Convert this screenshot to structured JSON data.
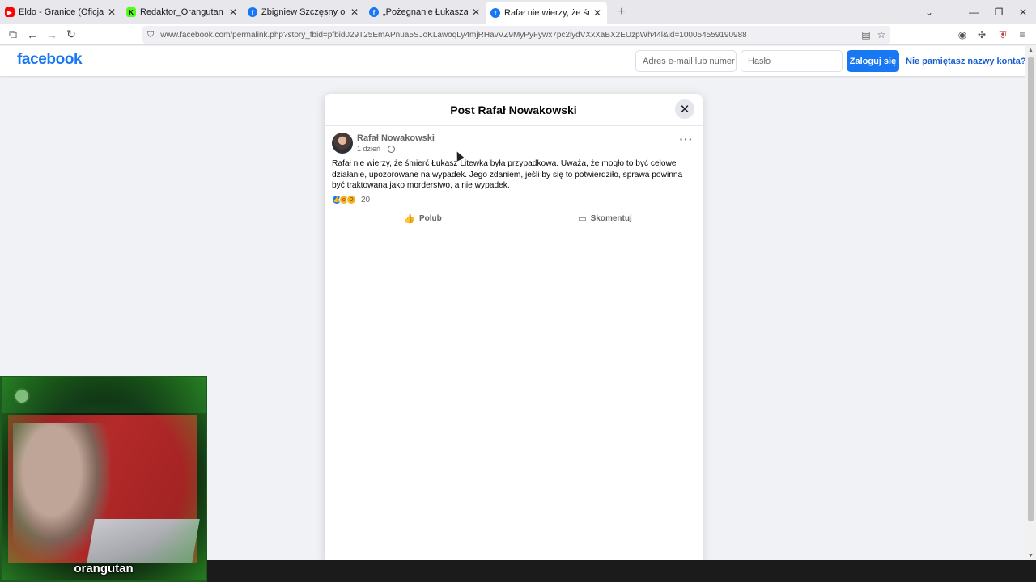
{
  "browser": {
    "tabs": [
      {
        "title": "Eldo - Granice (Oficjalny Teledysk)",
        "favicon": "youtube-icon",
        "color": "#ff0000",
        "active": false
      },
      {
        "title": "Redaktor_Orangutan Stream - W",
        "favicon": "kick-icon",
        "color": "#53fc18",
        "active": false
      },
      {
        "title": "Zbigniew Szczęsny on Reels | Fa",
        "favicon": "facebook-icon",
        "color": "#1877f2",
        "active": false
      },
      {
        "title": "„Pożegnanie Łukasza Litewki jes",
        "favicon": "facebook-icon",
        "color": "#1877f2",
        "active": false
      },
      {
        "title": "Rafał nie wierzy, że śmierć Łuka",
        "favicon": "facebook-icon",
        "color": "#1877f2",
        "active": true
      }
    ],
    "url": "www.facebook.com/permalink.php?story_fbid=pfbid029T25EmAPnua5SJoKLawoqLy4mjRHavVZ9MyPyFywx7pc2iydVXxXaBX2EUzpWh44l&id=100054559190988"
  },
  "fb_header": {
    "logo": "facebook",
    "email_placeholder": "Adres e-mail lub numer telefonu",
    "password_placeholder": "Hasło",
    "login_label": "Zaloguj się",
    "forgot_label": "Nie pamiętasz nazwy konta?"
  },
  "modal": {
    "title": "Post Rafał Nowakowski",
    "author": "Rafał Nowakowski",
    "time": "1 dzień",
    "text": "Rafał nie wierzy, że śmierć Łukasz Litewka była przypadkowa. Uważa, że mogło to być celowe działanie, upozorowane na wypadek. Jego zdaniem, jeśli by się to potwierdziło, sprawa powinna być traktowana jako morderstwo, a nie wypadek.",
    "reaction_count": "20",
    "like_label": "Polub",
    "comment_label": "Skomentuj"
  },
  "webcam": {
    "label": "orangutan"
  },
  "colors": {
    "brand": "#1877f2",
    "page_bg": "#f0f2f5"
  }
}
